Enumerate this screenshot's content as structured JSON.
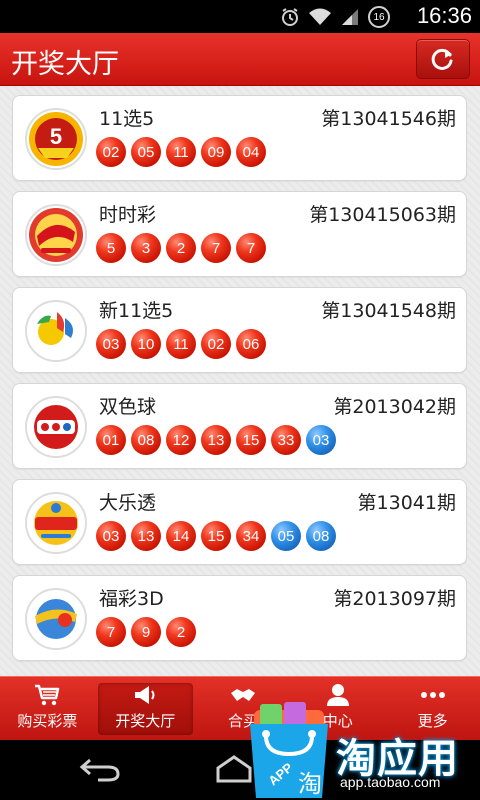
{
  "status_bar": {
    "time": "16:36",
    "badge": "16",
    "icons": [
      "alarm-icon",
      "wifi-icon",
      "signal-icon",
      "notification-badge-icon"
    ]
  },
  "header": {
    "title": "开奖大厅",
    "refresh_icon": "refresh-icon",
    "brand_color": "#d9241c"
  },
  "lotteries": [
    {
      "name": "11选5",
      "issue": "第13041546期",
      "logo": "11x5-logo",
      "numbers": [
        "02",
        "05",
        "11",
        "09",
        "04"
      ],
      "blue_numbers": []
    },
    {
      "name": "时时彩",
      "issue": "第130415063期",
      "logo": "ssc-logo",
      "numbers": [
        "5",
        "3",
        "2",
        "7",
        "7"
      ],
      "blue_numbers": []
    },
    {
      "name": "新11选5",
      "issue": "第13041548期",
      "logo": "new11x5-logo",
      "numbers": [
        "03",
        "10",
        "11",
        "02",
        "06"
      ],
      "blue_numbers": []
    },
    {
      "name": "双色球",
      "issue": "第2013042期",
      "logo": "ssq-logo",
      "numbers": [
        "01",
        "08",
        "12",
        "13",
        "15",
        "33"
      ],
      "blue_numbers": [
        "03"
      ]
    },
    {
      "name": "大乐透",
      "issue": "第13041期",
      "logo": "dlt-logo",
      "numbers": [
        "03",
        "13",
        "14",
        "15",
        "34"
      ],
      "blue_numbers": [
        "05",
        "08"
      ]
    },
    {
      "name": "福彩3D",
      "issue": "第2013097期",
      "logo": "fc3d-logo",
      "numbers": [
        "7",
        "9",
        "2"
      ],
      "blue_numbers": []
    }
  ],
  "tabs": [
    {
      "label": "购买彩票",
      "icon": "cart-icon",
      "active": false
    },
    {
      "label": "开奖大厅",
      "icon": "megaphone-icon",
      "active": true
    },
    {
      "label": "合买",
      "icon": "handshake-icon",
      "active": false
    },
    {
      "label": "中心",
      "icon": "user-icon",
      "active": false
    },
    {
      "label": "更多",
      "icon": "more-dots-icon",
      "active": false
    }
  ],
  "watermark": {
    "text": "淘应用",
    "url": "app.taobao.com",
    "bag_text": "APP",
    "bag_char": "淘"
  },
  "nav_bar": {
    "icons": [
      "back-icon",
      "home-icon"
    ]
  }
}
